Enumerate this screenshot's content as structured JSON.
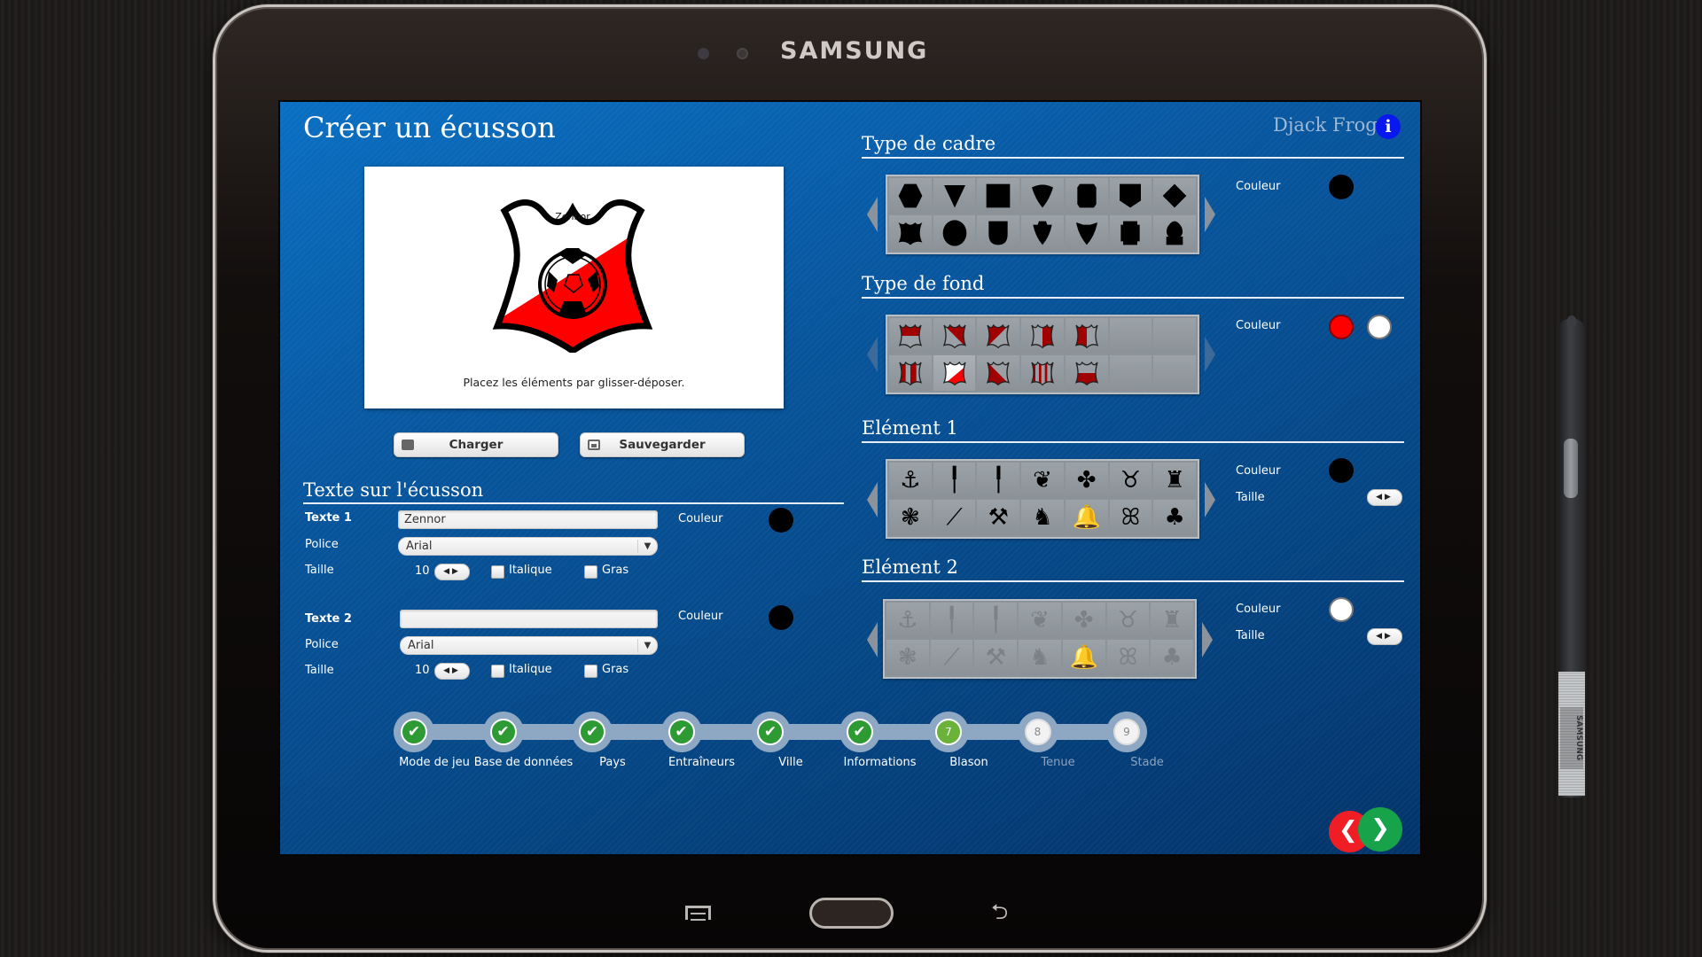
{
  "device": {
    "brand": "SAMSUNG",
    "stylus_brand": "SAMSUNG"
  },
  "header": {
    "title": "Créer un écusson",
    "user_name": "Djack Frog",
    "info_icon": "i"
  },
  "preview": {
    "crest_text": "Zennor",
    "hint": "Placez les éléments par glisser-déposer.",
    "crest_colors": {
      "primary": "#ff0000",
      "secondary": "#ffffff",
      "outline": "#000000"
    }
  },
  "actions": {
    "load_label": "Charger",
    "save_label": "Sauvegarder"
  },
  "text_section": {
    "title": "Texte sur l'écusson",
    "texts": [
      {
        "label": "Texte 1",
        "value": "Zennor",
        "color_label": "Couleur",
        "color": "#000000",
        "font_label": "Police",
        "font_value": "Arial",
        "size_label": "Taille",
        "size_value": "10",
        "italic_label": "Italique",
        "italic": false,
        "bold_label": "Gras",
        "bold": false
      },
      {
        "label": "Texte 2",
        "value": "",
        "color_label": "Couleur",
        "color": "#000000",
        "font_label": "Police",
        "font_value": "Arial",
        "size_label": "Taille",
        "size_value": "10",
        "italic_label": "Italique",
        "italic": false,
        "bold_label": "Gras",
        "bold": false
      }
    ]
  },
  "frame_type": {
    "title": "Type de cadre",
    "color_label": "Couleur",
    "color": "#000000",
    "shapes": [
      "hexagon",
      "triangle-down",
      "square",
      "pointed-shield",
      "rounded-rect",
      "pentagon-shield",
      "diamond",
      "scalloped-shield",
      "circle",
      "rounded-shield",
      "crowned-shield",
      "notched-shield",
      "notched-rect",
      "arch-base"
    ]
  },
  "background_type": {
    "title": "Type de fond",
    "color_label": "Couleur",
    "colors": [
      "#ff0000",
      "#ffffff"
    ],
    "patterns": [
      "top-half",
      "diagonal-left",
      "diagonal-right",
      "vertical-split-right",
      "vertical-split-left",
      "",
      "",
      "stripes",
      "diagonal-selected",
      "diagonal-bottom",
      "thin-stripes",
      "bottom-half",
      "",
      ""
    ]
  },
  "element1": {
    "title": "Elément 1",
    "color_label": "Couleur",
    "color": "#000000",
    "size_label": "Taille",
    "icons": [
      "anchor",
      "axe",
      "halberd",
      "bat",
      "bee",
      "bull",
      "tower",
      "thistle",
      "spear",
      "hammer",
      "lion",
      "bell",
      "butterfly",
      "clover"
    ],
    "glyphs": [
      "⚓",
      "╿",
      "╿",
      "❦",
      "✤",
      "♉",
      "♜",
      "❃",
      "⟋",
      "⚒",
      "♞",
      "🔔",
      "ꕤ",
      "♣"
    ]
  },
  "element2": {
    "title": "Elément 2",
    "color_label": "Couleur",
    "color": "#ffffff",
    "size_label": "Taille",
    "icons": [
      "anchor",
      "axe",
      "halberd",
      "bat",
      "bee",
      "bull",
      "tower",
      "thistle",
      "spear",
      "hammer",
      "lion",
      "bell",
      "butterfly",
      "clover"
    ],
    "glyphs": [
      "⚓",
      "╿",
      "╿",
      "❦",
      "✤",
      "♉",
      "♜",
      "❃",
      "⟋",
      "⚒",
      "♞",
      "🔔",
      "ꕤ",
      "♣"
    ]
  },
  "progress": {
    "steps": [
      {
        "label": "Mode de jeu",
        "status": "done",
        "marker": "✔"
      },
      {
        "label": "Base de données",
        "status": "done",
        "marker": "✔"
      },
      {
        "label": "Pays",
        "status": "done",
        "marker": "✔"
      },
      {
        "label": "Entraîneurs",
        "status": "done",
        "marker": "✔"
      },
      {
        "label": "Ville",
        "status": "done",
        "marker": "✔"
      },
      {
        "label": "Informations",
        "status": "done",
        "marker": "✔"
      },
      {
        "label": "Blason",
        "status": "current",
        "marker": "7"
      },
      {
        "label": "Tenue",
        "status": "todo",
        "marker": "8"
      },
      {
        "label": "Stade",
        "status": "todo",
        "marker": "9"
      }
    ],
    "current_step": 7,
    "total_steps": 9
  },
  "navigation": {
    "prev_glyph": "❮",
    "next_glyph": "❯"
  },
  "stepper_glyph": "◀▶",
  "select_arrow": "▼",
  "back_glyph": "⮌"
}
